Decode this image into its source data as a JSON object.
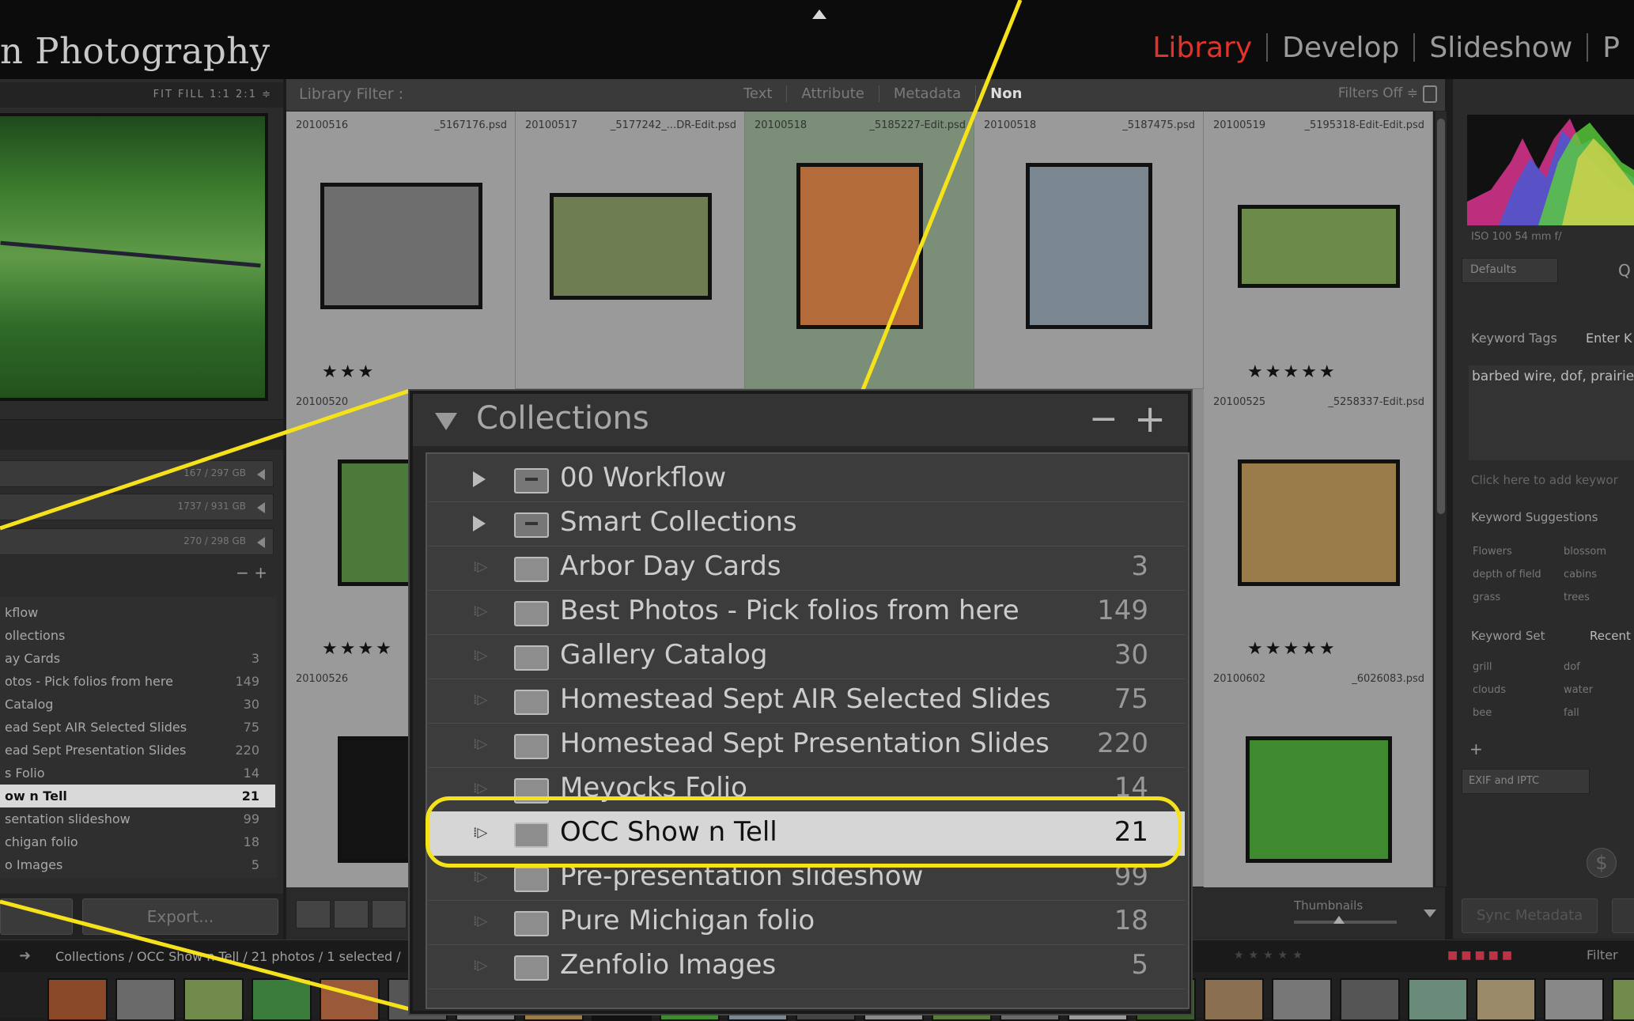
{
  "app": {
    "brand": "n Photography",
    "modules": [
      {
        "label": "Library",
        "active": true
      },
      {
        "label": "Develop",
        "active": false
      },
      {
        "label": "Slideshow",
        "active": false
      },
      {
        "label": "P",
        "active": false
      }
    ]
  },
  "navigator": {
    "zoom_labels": "FIT  FILL  1:1  2:1 ≑"
  },
  "volumes": [
    {
      "size": "167 / 297 GB"
    },
    {
      "size": "1737 / 931 GB"
    },
    {
      "size": "270 / 298 GB"
    }
  ],
  "left_collections": {
    "header_controls": "− +",
    "items": [
      {
        "name": "kflow",
        "count": ""
      },
      {
        "name": "ollections",
        "count": ""
      },
      {
        "name": "ay Cards",
        "count": "3"
      },
      {
        "name": "otos - Pick folios from here",
        "count": "149"
      },
      {
        "name": "Catalog",
        "count": "30"
      },
      {
        "name": "ead Sept AIR Selected Slides",
        "count": "75"
      },
      {
        "name": "ead Sept Presentation Slides",
        "count": "220"
      },
      {
        "name": "s Folio",
        "count": "14"
      },
      {
        "name": "ow n Tell",
        "count": "21",
        "selected": true
      },
      {
        "name": "sentation slideshow",
        "count": "99"
      },
      {
        "name": "chigan folio",
        "count": "18"
      },
      {
        "name": "o Images",
        "count": "5"
      }
    ],
    "export_label": "Export..."
  },
  "filter_bar": {
    "title": "Library Filter :",
    "tabs": [
      {
        "label": "Text",
        "on": false
      },
      {
        "label": "Attribute",
        "on": false
      },
      {
        "label": "Metadata",
        "on": false
      },
      {
        "label": "Non",
        "on": true
      }
    ],
    "filters_state": "Filters Off ≑"
  },
  "grid": {
    "cells": [
      {
        "date": "20100516",
        "file": "_5167176.psd",
        "stars": "★★★",
        "color": "#6e6e6e"
      },
      {
        "date": "20100517",
        "file": "_5177242_...DR-Edit.psd",
        "stars": "",
        "color": "#6f7d52"
      },
      {
        "date": "20100518",
        "file": "_5185227-Edit.psd",
        "stars": "",
        "color": "#b46b3a"
      },
      {
        "date": "20100518",
        "file": "_5187475.psd",
        "stars": "",
        "color": "#7a8790"
      },
      {
        "date": "20100519",
        "file": "_5195318-Edit-Edit.psd",
        "stars": "★★★★★",
        "color": "#6c8a4a"
      },
      {
        "date": "20100520",
        "file": "",
        "stars": "★★★★",
        "color": "#4c7a3a"
      },
      {
        "date": "20100525",
        "file": "_5258337-Edit.psd",
        "stars": "★★★★★",
        "color": "#9a7c4a"
      },
      {
        "date": "20100526",
        "file": "",
        "stars": "",
        "color": "#141414"
      },
      {
        "date": "20100602",
        "file": "_6026083.psd",
        "stars": "",
        "color": "#3f8a2f"
      }
    ],
    "thumbnails_label": "Thumbnails"
  },
  "right_panel": {
    "histogram_info": "ISO 100     54 mm     f/",
    "quick_preset": "Defaults",
    "quick_label": "Q",
    "keyword_tags_label": "Keyword Tags",
    "keyword_mode": "Enter K",
    "keywords": "barbed wire, dof, prairie,",
    "add_keyword_hint": "Click here to add keywor",
    "suggestions_label": "Keyword Suggestions",
    "suggestions": [
      "Flowers",
      "blossom",
      "depth of field",
      "cabins",
      "grass",
      "trees"
    ],
    "keyword_set_label": "Keyword Set",
    "keyword_set_value": "Recent",
    "set_keywords": [
      "grill",
      "dof",
      "clouds",
      "water",
      "bee",
      "fall"
    ],
    "metadata_preset": "EXIF and IPTC",
    "sync_label": "Sync Metadata"
  },
  "status": {
    "path": "Collections / OCC Show n Tell / 21 photos / 1 selected /",
    "filter_label": "Filter"
  },
  "collections_panel": {
    "title": "Collections",
    "minus_label": "−",
    "plus_label": "+",
    "items": [
      {
        "name": "00 Workflow",
        "count": "",
        "type": "set"
      },
      {
        "name": "Smart Collections",
        "count": "",
        "type": "set"
      },
      {
        "name": "Arbor Day Cards",
        "count": "3",
        "type": "collection"
      },
      {
        "name": "Best Photos - Pick folios from here",
        "count": "149",
        "type": "collection"
      },
      {
        "name": "Gallery Catalog",
        "count": "30",
        "type": "collection"
      },
      {
        "name": "Homestead Sept AIR Selected Slides",
        "count": "75",
        "type": "collection"
      },
      {
        "name": "Homestead Sept Presentation Slides",
        "count": "220",
        "type": "collection"
      },
      {
        "name": "Meyocks Folio",
        "count": "14",
        "type": "collection"
      },
      {
        "name": "OCC Show n Tell",
        "count": "21",
        "type": "collection",
        "selected": true
      },
      {
        "name": "Pre-presentation slideshow",
        "count": "99",
        "type": "collection"
      },
      {
        "name": "Pure Michigan folio",
        "count": "18",
        "type": "collection"
      },
      {
        "name": "Zenfolio Images",
        "count": "5",
        "type": "collection"
      }
    ]
  },
  "colors": {
    "accent_active_module": "#e2332b",
    "callout_yellow": "#f6e21a",
    "selected_row": "#d6d6d6"
  }
}
